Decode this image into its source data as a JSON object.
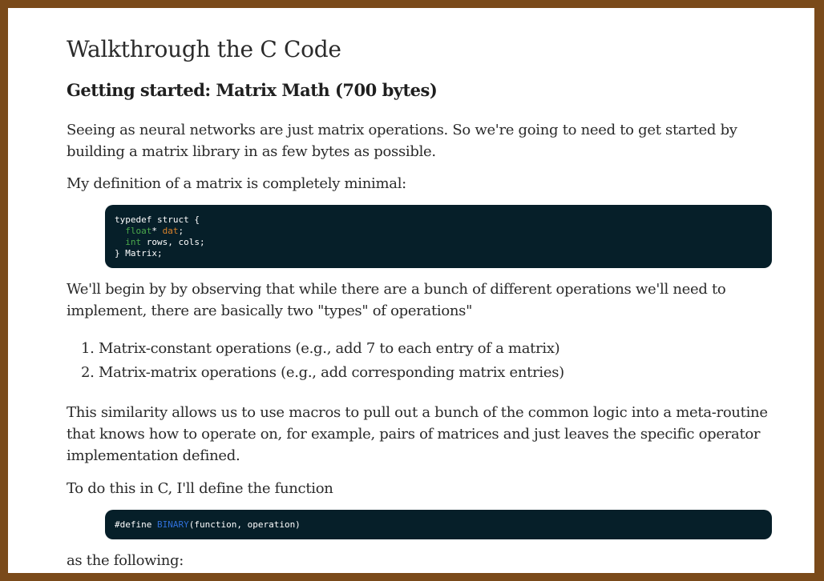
{
  "title": "Walkthrough the C Code",
  "subtitle": "Getting started: Matrix Math (700 bytes)",
  "para1": "Seeing as neural networks are just matrix operations. So we're going to need to get started by building a matrix library in as few bytes as possible.",
  "para2": "My definition of a matrix is completely minimal:",
  "code1": {
    "line1": "typedef struct {",
    "line2_type": "float",
    "line2_rest1": "* ",
    "line2_var": "dat",
    "line2_end": ";",
    "line3_type": "int",
    "line3_rest": " rows, cols;",
    "line4": "} Matrix;"
  },
  "para3": "We'll begin by by observing that while there are a bunch of different operations we'll need to implement, there are basically two \"types\" of operations\"",
  "list": [
    "Matrix-constant operations (e.g., add 7 to each entry of a matrix)",
    "Matrix-matrix operations (e.g., add corresponding matrix entries)"
  ],
  "para4": "This similarity allows us to use macros to pull out a bunch of the common logic into a meta-routine that knows how to operate on, for example, pairs of matrices and just leaves the specific operator implementation defined.",
  "para5": "To do this in C, I'll define the function",
  "code2": {
    "kw": "#define ",
    "fn": "BINARY",
    "args": "(function, operation)"
  },
  "para6": "as the following:",
  "colors": {
    "frame": "#7a4a1a",
    "code_bg": "#061f29",
    "type_kw": "#4cab4c",
    "var": "#d9822b",
    "macro_name": "#2f6fd8"
  }
}
